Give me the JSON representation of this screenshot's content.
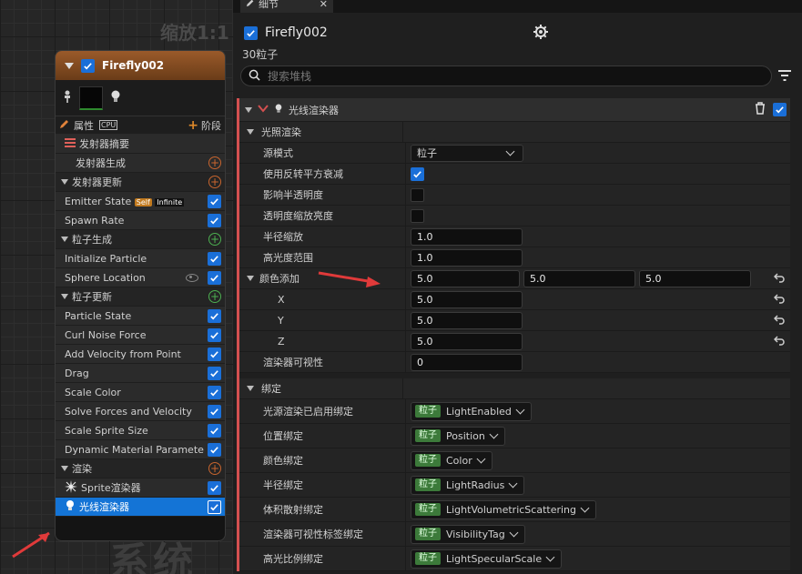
{
  "graph": {
    "zoom_label": "缩放1:1",
    "watermark": "系统"
  },
  "node": {
    "title": "Firefly002",
    "attr_label": "属性",
    "cpu_label": "CPU",
    "stage_label": "阶段",
    "rows": [
      {
        "label": "发射器摘要"
      },
      {
        "label": "发射器生成"
      },
      {
        "label": "发射器更新"
      },
      {
        "label": "Emitter State",
        "badge1": "Self",
        "badge2": "Infinite"
      },
      {
        "label": "Spawn Rate"
      },
      {
        "label": "粒子生成"
      },
      {
        "label": "Initialize Particle"
      },
      {
        "label": "Sphere Location"
      },
      {
        "label": "粒子更新"
      },
      {
        "label": "Particle State"
      },
      {
        "label": "Curl Noise Force"
      },
      {
        "label": "Add Velocity from Point"
      },
      {
        "label": "Drag"
      },
      {
        "label": "Scale Color"
      },
      {
        "label": "Solve Forces and Velocity"
      },
      {
        "label": "Scale Sprite Size"
      },
      {
        "label": "Dynamic Material Parameters"
      },
      {
        "label": "渲染"
      },
      {
        "label": "Sprite渲染器"
      },
      {
        "label": "光线渲染器"
      }
    ]
  },
  "details": {
    "tab_label": "细节",
    "object_name": "Firefly002",
    "particle_count": "30粒子",
    "search_placeholder": "搜索堆栈",
    "section_title": "光线渲染器",
    "lighting": {
      "category": "光照渲染",
      "source_mode_label": "源模式",
      "source_mode_value": "粒子",
      "inverse_sq_label": "使用反转平方衰减",
      "affect_trans_label": "影响半透明度",
      "opacity_scale_label": "透明度缩放亮度",
      "radius_scale_label": "半径缩放",
      "radius_scale_value": "1.0",
      "exposure_label": "高光度范围",
      "exposure_value": "1.0",
      "color_add_label": "颜色添加",
      "color_add_values": [
        "5.0",
        "5.0",
        "5.0"
      ],
      "x_label": "X",
      "x_value": "5.0",
      "y_label": "Y",
      "y_value": "5.0",
      "z_label": "Z",
      "z_value": "5.0",
      "visibility_label": "渲染器可视性",
      "visibility_value": "0"
    },
    "bindings": {
      "category": "绑定",
      "scope": "粒子",
      "rows": [
        {
          "label": "光源渲染已启用绑定",
          "value": "LightEnabled"
        },
        {
          "label": "位置绑定",
          "value": "Position"
        },
        {
          "label": "颜色绑定",
          "value": "Color"
        },
        {
          "label": "半径绑定",
          "value": "LightRadius"
        },
        {
          "label": "体积散射绑定",
          "value": "LightVolumetricScattering"
        },
        {
          "label": "渲染器可视性标签绑定",
          "value": "VisibilityTag"
        },
        {
          "label": "高光比例绑定",
          "value": "LightSpecularScale"
        }
      ]
    }
  },
  "colors": {
    "accent": "#1a6fd8",
    "annotation_arrow": "#e03a3a",
    "header_orange": "#9a5a2a",
    "binding_pill": "#3c7a3a"
  }
}
